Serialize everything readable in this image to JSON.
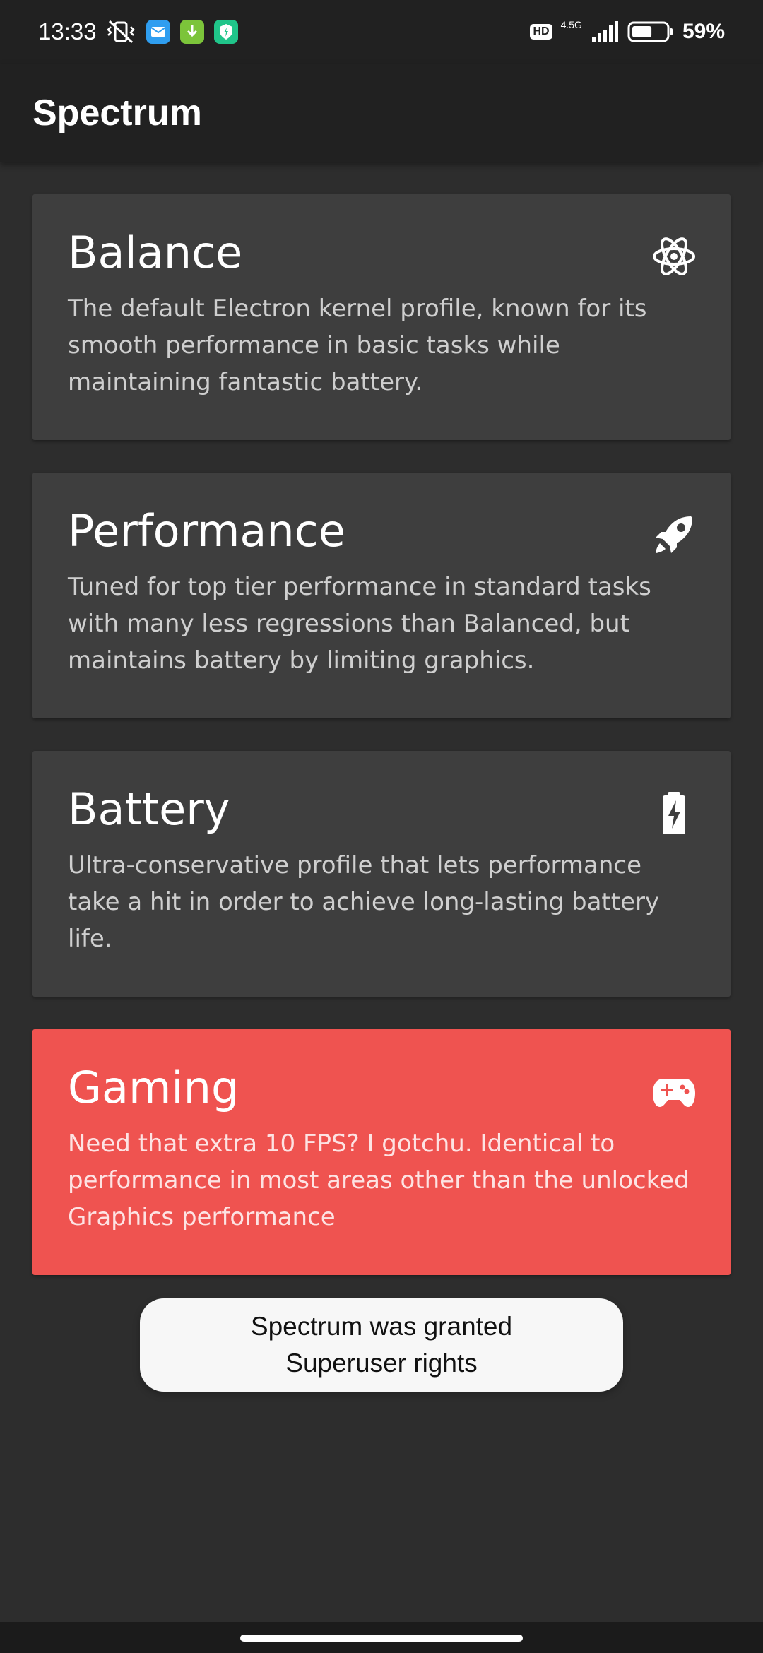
{
  "status_bar": {
    "time": "13:33",
    "network_type": "4.5G",
    "hd_label": "HD",
    "battery_percent": "59%",
    "battery_level": 0.59
  },
  "app_bar": {
    "title": "Spectrum"
  },
  "profiles": [
    {
      "title": "Balance",
      "description": "The default Electron kernel profile, known for its smooth performance in basic tasks while maintaining fantastic battery.",
      "icon": "atom-icon",
      "selected": false
    },
    {
      "title": "Performance",
      "description": "Tuned for top tier performance in standard tasks with many less regressions than Balanced, but maintains battery by limiting graphics.",
      "icon": "rocket-icon",
      "selected": false
    },
    {
      "title": "Battery",
      "description": "Ultra-conservative profile that lets performance take a hit in order to achieve long-lasting battery life.",
      "icon": "battery-charging-icon",
      "selected": false
    },
    {
      "title": "Gaming",
      "description": "Need that extra 10 FPS? I gotchu. Identical to performance in most areas other than the unlocked Graphics performance",
      "icon": "gamepad-icon",
      "selected": true
    }
  ],
  "toast": {
    "message": "Spectrum was granted Superuser rights"
  },
  "colors": {
    "background": "#2d2d2d",
    "app_bar": "#212121",
    "card": "#3e3e3e",
    "selected_card": "#ef5350",
    "toast": "#f7f7f7"
  }
}
